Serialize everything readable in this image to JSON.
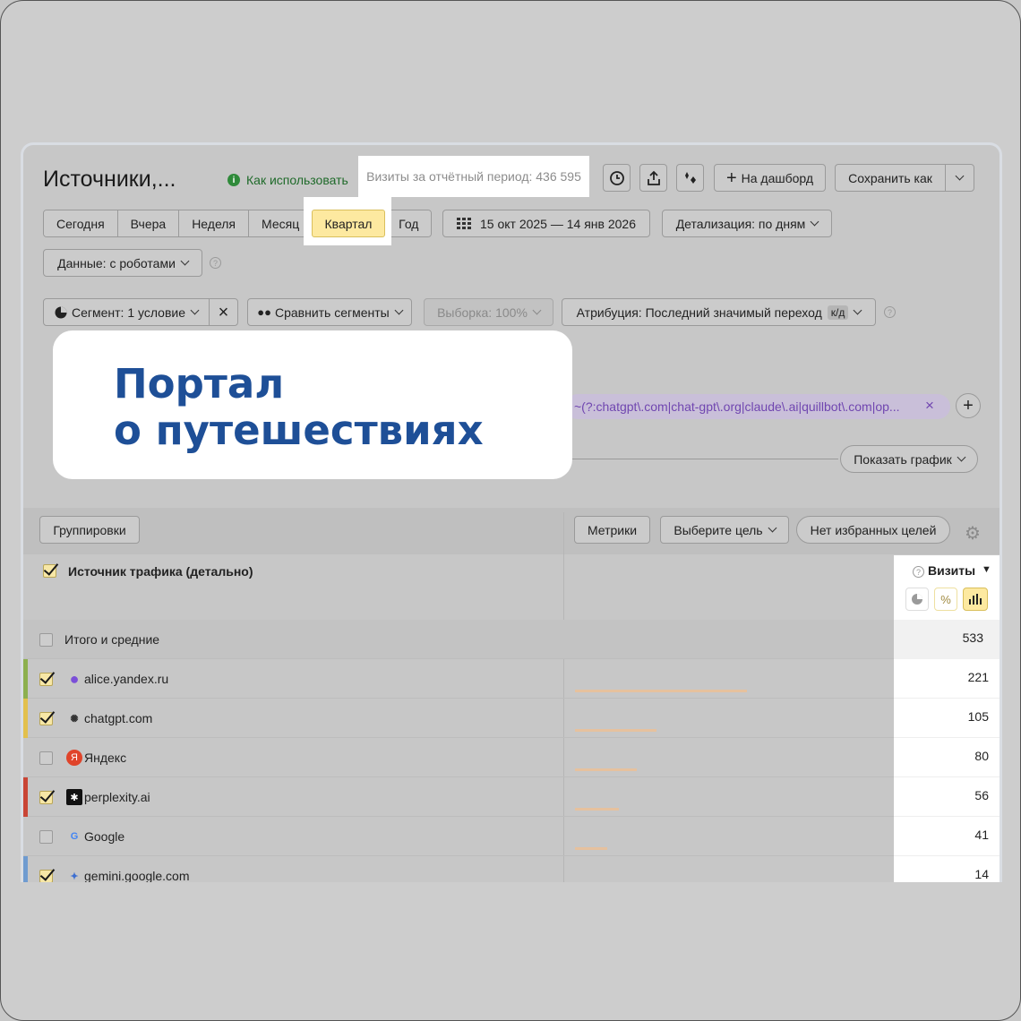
{
  "header": {
    "title": "Источники,...",
    "how_to_use": "Как использовать",
    "visits_period": "Визиты за отчётный период: 436 595",
    "to_dashboard": "На дашборд",
    "save_as": "Сохранить как"
  },
  "periods": {
    "today": "Сегодня",
    "yesterday": "Вчера",
    "week": "Неделя",
    "month": "Месяц",
    "quarter": "Квартал",
    "year": "Год",
    "active": "Квартал"
  },
  "date_range": "15 окт 2025 — 14 янв 2026",
  "detail": "Детализация: по дням",
  "data_robots": "Данные: с роботами",
  "filters": {
    "segment": "Сегмент: 1 условие",
    "compare": "Сравнить сегменты",
    "sample": "Выборка: 100%",
    "attribution": "Атрибуция: Последний значимый переход",
    "attribution_badge": "к/д"
  },
  "regex_filter": "~(?:chatgpt\\.com|chat-gpt\\.org|claude\\.ai|quillbot\\.com|op...",
  "show_chart": "Показать график",
  "overlay": {
    "line1": "Портал",
    "line2": "о путешествиях"
  },
  "table": {
    "groupings": "Группировки",
    "metrics": "Метрики",
    "choose_goal": "Выберите цель",
    "no_fav_goals": "Нет избранных целей",
    "dimension_header": "Источник трафика (детально)",
    "metric_header": "Визиты",
    "total_label": "Итого и средние",
    "total_value": "533",
    "max_value": 533,
    "rows": [
      {
        "name": "alice.yandex.ru",
        "value": "221",
        "checked": true,
        "stripe": "#8db04f",
        "icon": "alice-icon",
        "icon_color": "#7b4fd8"
      },
      {
        "name": "chatgpt.com",
        "value": "105",
        "checked": true,
        "stripe": "#e2c04d",
        "icon": "chatgpt-icon",
        "icon_color": "#333333"
      },
      {
        "name": "Яндекс",
        "value": "80",
        "checked": false,
        "stripe": "",
        "icon": "yandex-icon",
        "icon_color": "#e0442a"
      },
      {
        "name": "perplexity.ai",
        "value": "56",
        "checked": true,
        "stripe": "#c94536",
        "icon": "perplexity-icon",
        "icon_color": "#111111"
      },
      {
        "name": "Google",
        "value": "41",
        "checked": false,
        "stripe": "",
        "icon": "google-icon",
        "icon_color": "#4285f4"
      },
      {
        "name": "gemini.google.com",
        "value": "14",
        "checked": true,
        "stripe": "#6f9bd0",
        "icon": "gemini-icon",
        "icon_color": "#3d6fd1"
      }
    ]
  }
}
